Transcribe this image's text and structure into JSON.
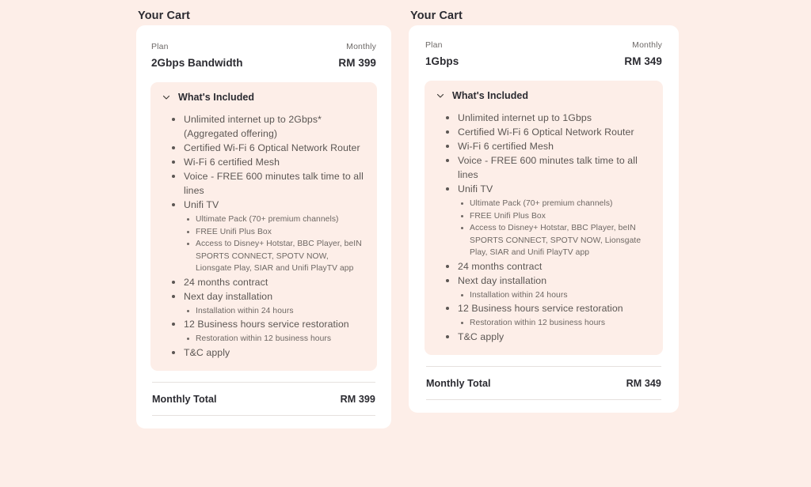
{
  "page": {
    "background_color": "#fdeee8",
    "card_color": "#ffffff",
    "panel_color": "#fdeee8",
    "heading_color": "#2b2b31",
    "body_text_color": "#5b5653"
  },
  "carts": [
    {
      "heading": "Your Cart",
      "plan_label": "Plan",
      "plan_value": "2Gbps Bandwidth",
      "price_label": "Monthly",
      "price_value": "RM 399",
      "included": {
        "icon": "chevron-down-icon",
        "title": "What's Included",
        "items": [
          {
            "text": "Unlimited internet up to 2Gbps* (Aggregated offering)"
          },
          {
            "text": "Certified Wi-Fi 6 Optical Network Router"
          },
          {
            "text": "Wi-Fi 6 certified Mesh"
          },
          {
            "text": "Voice - FREE 600 minutes talk time to all lines"
          },
          {
            "text": "Unifi TV",
            "sub": [
              "Ultimate Pack (70+ premium channels)",
              "FREE Unifi Plus Box",
              "Access to Disney+ Hotstar, BBC Player, beIN SPORTS CONNECT, SPOTV NOW, Lionsgate Play, SIAR and Unifi PlayTV app"
            ]
          },
          {
            "text": "24 months contract"
          },
          {
            "text": "Next day installation",
            "sub": [
              "Installation within 24 hours"
            ]
          },
          {
            "text": "12 Business hours service restoration",
            "sub": [
              "Restoration within 12 business hours"
            ]
          },
          {
            "text": "T&C apply"
          }
        ]
      },
      "total_label": "Monthly Total",
      "total_value": "RM 399"
    },
    {
      "heading": "Your Cart",
      "plan_label": "Plan",
      "plan_value": "1Gbps",
      "price_label": "Monthly",
      "price_value": "RM 349",
      "included": {
        "icon": "chevron-down-icon",
        "title": "What's Included",
        "items": [
          {
            "text": "Unlimited internet up to 1Gbps"
          },
          {
            "text": "Certified Wi-Fi 6 Optical Network Router"
          },
          {
            "text": "Wi-Fi 6 certified Mesh"
          },
          {
            "text": "Voice - FREE 600 minutes talk time to all lines"
          },
          {
            "text": "Unifi TV",
            "sub": [
              "Ultimate Pack (70+ premium channels)",
              "FREE Unifi Plus Box",
              "Access to Disney+ Hotstar, BBC Player, beIN SPORTS CONNECT, SPOTV NOW, Lionsgate Play, SIAR and Unifi PlayTV app"
            ]
          },
          {
            "text": "24 months contract"
          },
          {
            "text": "Next day installation",
            "sub": [
              "Installation within 24 hours"
            ]
          },
          {
            "text": "12 Business hours service restoration",
            "sub": [
              "Restoration within 12 business hours"
            ]
          },
          {
            "text": "T&C apply"
          }
        ]
      },
      "total_label": "Monthly Total",
      "total_value": "RM 349"
    }
  ]
}
